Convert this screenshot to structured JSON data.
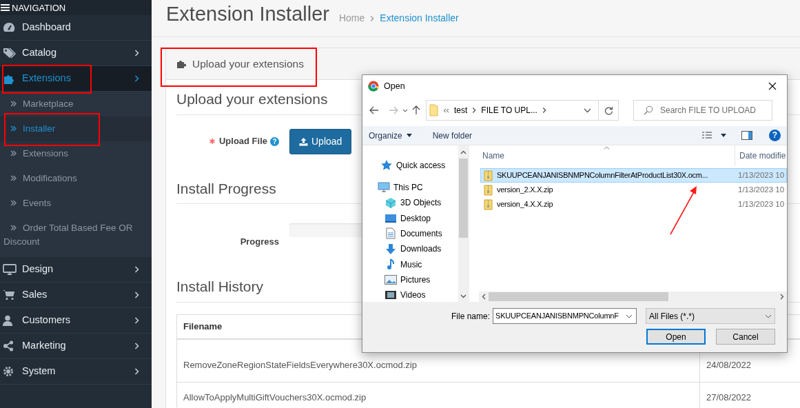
{
  "sidebar": {
    "header": "NAVIGATION",
    "items": [
      {
        "label": "Dashboard",
        "has_submenu": false,
        "selected": false,
        "annotated": false
      },
      {
        "label": "Catalog",
        "has_submenu": true,
        "selected": false,
        "annotated": false
      },
      {
        "label": "Extensions",
        "has_submenu": true,
        "selected": true,
        "annotated": true,
        "children": [
          {
            "label": "Marketplace",
            "selected": false,
            "annotated": false
          },
          {
            "label": "Installer",
            "selected": true,
            "annotated": true
          },
          {
            "label": "Extensions",
            "selected": false,
            "annotated": false
          },
          {
            "label": "Modifications",
            "selected": false,
            "annotated": false
          },
          {
            "label": "Events",
            "selected": false,
            "annotated": false
          },
          {
            "label": "Order Total Based Fee OR Discount",
            "selected": false,
            "annotated": false
          }
        ]
      },
      {
        "label": "Design",
        "has_submenu": true,
        "selected": false,
        "annotated": false
      },
      {
        "label": "Sales",
        "has_submenu": true,
        "selected": false,
        "annotated": false
      },
      {
        "label": "Customers",
        "has_submenu": true,
        "selected": false,
        "annotated": false
      },
      {
        "label": "Marketing",
        "has_submenu": true,
        "selected": false,
        "annotated": false
      },
      {
        "label": "System",
        "has_submenu": true,
        "selected": false,
        "annotated": false
      }
    ]
  },
  "page": {
    "title": "Extension Installer",
    "breadcrumb": [
      "Home",
      "Extension Installer"
    ],
    "panel": {
      "heading": "Upload your extensions",
      "annotated": true,
      "upload": {
        "title": "Upload your extensions",
        "label": "Upload File",
        "required": true,
        "help": "?",
        "button": "Upload"
      },
      "progress": {
        "title": "Install Progress",
        "label": "Progress",
        "level": 0
      },
      "history": {
        "title": "Install History",
        "columns": [
          "Filename"
        ],
        "rows": [
          {
            "cells": [
              "RemoveZoneRegionStateFieldsEverywhere30X.ocmod.zip",
              "24/08/2022"
            ]
          },
          {
            "cells": [
              "AllowToApplyMultiGiftVouchers30X.ocmod.zip",
              "27/08/2022"
            ]
          }
        ]
      }
    }
  },
  "dialog": {
    "title": "Open",
    "path": [
      "test",
      "FILE TO UPL..."
    ],
    "search_placeholder": "Search FILE TO UPLOAD",
    "toolbar": [
      {
        "label": "Organize",
        "dropdown": true
      },
      {
        "label": "New folder",
        "dropdown": false
      }
    ],
    "help": "?",
    "nav_pane": [
      {
        "label": "Quick access"
      },
      {
        "label": "This PC",
        "children": [
          {
            "label": "3D Objects"
          },
          {
            "label": "Desktop"
          },
          {
            "label": "Documents"
          },
          {
            "label": "Downloads"
          },
          {
            "label": "Music"
          },
          {
            "label": "Pictures"
          },
          {
            "label": "Videos"
          }
        ]
      }
    ],
    "columns": [
      "Name",
      "Date modifie"
    ],
    "files": [
      {
        "name": "SKUUPCEANJANISBNMPNColumnFilterAtProductList30X.ocm...",
        "date": "1/13/2023 10",
        "selected": true
      },
      {
        "name": "version_2.X.X.zip",
        "date": "1/13/2023 10",
        "selected": false
      },
      {
        "name": "version_4.X.X.zip",
        "date": "1/13/2023 10",
        "selected": false
      }
    ],
    "pointer_arrow": true,
    "file_name_label": "File name:",
    "file_name": "SKUUPCEANJANISBNMPNColumnF",
    "filter": "All Files (*.*)",
    "buttons": [
      {
        "label": "Open",
        "default": true
      },
      {
        "label": "Cancel",
        "default": false
      }
    ]
  }
}
